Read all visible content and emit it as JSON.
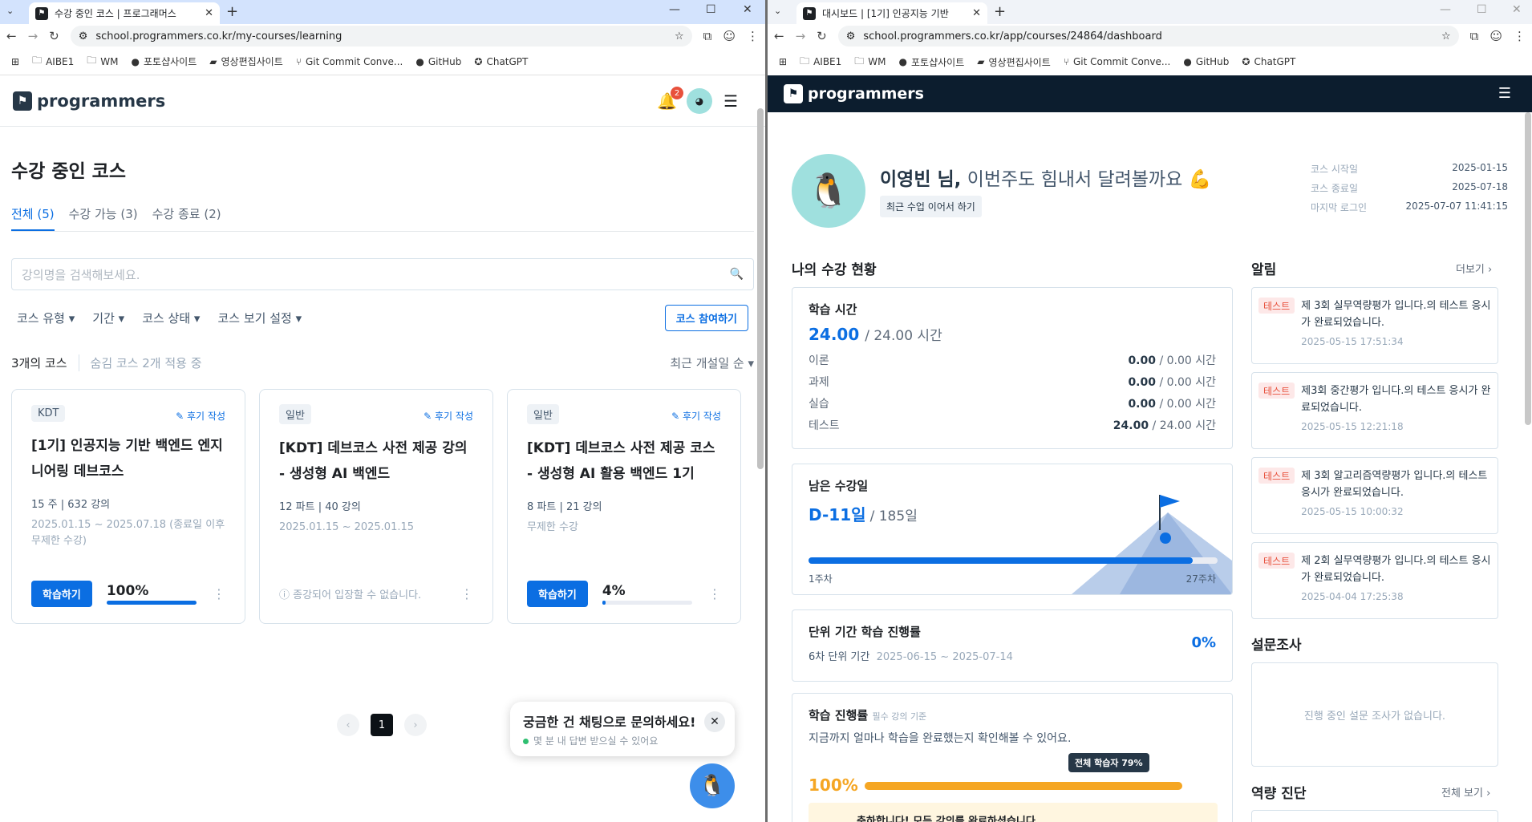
{
  "left": {
    "tab_title": "수강 중인 코스 | 프로그래머스",
    "url": "school.programmers.co.kr/my-courses/learning",
    "bookmarks": [
      "AIBE1",
      "WM",
      "포토샵사이트",
      "영상편집사이트",
      "Git Commit Conve...",
      "GitHub",
      "ChatGPT"
    ],
    "logo": "programmers",
    "notif_count": "2",
    "page_title": "수강 중인 코스",
    "tabs": [
      "전체 (5)",
      "수강 가능 (3)",
      "수강 종료 (2)"
    ],
    "search_placeholder": "강의명을 검색해보세요.",
    "filters": [
      "코스 유형 ▾",
      "기간 ▾",
      "코스 상태 ▾",
      "코스 보기 설정 ▾"
    ],
    "join_button": "코스 참여하기",
    "count": "3개의 코스",
    "hidden": "숨김 코스 2개 적용 중",
    "sort": "최근 개설일 순 ▾",
    "review_label": "후기 작성",
    "cards": [
      {
        "type": "KDT",
        "title": "[1기] 인공지능 기반 백엔드 엔지니어링 데브코스",
        "meta": "15 주 | 632 강의",
        "dates": "2025.01.15 ~ 2025.07.18 (종료일 이후 무제한 수강)",
        "button": "학습하기",
        "progress": "100%",
        "progress_value": 100,
        "note": ""
      },
      {
        "type": "일반",
        "title": "[KDT] 데브코스 사전 제공 강의 - 생성형 AI 백엔드",
        "meta": "12 파트 | 40 강의",
        "dates": "2025.01.15 ~ 2025.01.15",
        "button": "",
        "progress": "",
        "progress_value": 0,
        "note": "ⓘ 종강되어 입장할 수 없습니다."
      },
      {
        "type": "일반",
        "title": "[KDT] 데브코스 사전 제공 코스 - 생성형 AI 활용 백엔드 1기",
        "meta": "8 파트 | 21 강의",
        "dates": "무제한 수강",
        "button": "학습하기",
        "progress": "4%",
        "progress_value": 4,
        "note": ""
      }
    ],
    "page_num": "1",
    "chat_title": "궁금한 건 채팅으로 문의하세요!",
    "chat_sub": "몇 분 내 답변 받으실 수 있어요"
  },
  "right": {
    "tab_title": "대시보드 | [1기] 인공지능 기반",
    "url": "school.programmers.co.kr/app/courses/24864/dashboard",
    "logo": "programmers",
    "name": "이영빈 님,",
    "greeting": "이번주도 힘내서 달려볼까요 💪",
    "continue_btn": "최근 수업 이어서 하기",
    "info": [
      {
        "k": "코스 시작일",
        "v": "2025-01-15"
      },
      {
        "k": "코스 종료일",
        "v": "2025-07-18"
      },
      {
        "k": "마지막 로그인",
        "v": "2025-07-07 11:41:15"
      }
    ],
    "status_title": "나의 수강 현황",
    "study_time_label": "학습 시간",
    "study_time_value": "24.00",
    "study_time_total": "/ 24.00 시간",
    "study_rows": [
      {
        "k": "이론",
        "v": "0.00",
        "t": "/ 0.00 시간"
      },
      {
        "k": "과제",
        "v": "0.00",
        "t": "/ 0.00 시간"
      },
      {
        "k": "실습",
        "v": "0.00",
        "t": "/ 0.00 시간"
      },
      {
        "k": "테스트",
        "v": "24.00",
        "t": "/ 24.00 시간"
      }
    ],
    "remain_label": "남은 수강일",
    "remain_value": "D-11일",
    "remain_total": "/ 185일",
    "remain_progress": 94,
    "week_start": "1주차",
    "week_end": "27주차",
    "unit_label": "단위 기간 학습 진행률",
    "unit_period": "6차 단위 기간",
    "unit_dates": "2025-06-15 ~ 2025-07-14",
    "unit_pct": "0%",
    "prog_label": "학습 진행률",
    "prog_sub": "필수 강의 기준",
    "prog_desc": "지금까지 얼마나 학습을 완료했는지 확인해볼 수 있어요.",
    "prog_tip": "전체 학습자 79%",
    "prog_value": "100%",
    "prog_fill": 100,
    "congrats": "축하합니다! 모든 강의를 완료하셨습니다.",
    "alarm_title": "알림",
    "more": "더보기 ›",
    "alarms": [
      {
        "tag": "테스트",
        "text": "제 3회 실무역량평가 입니다.의 테스트 응시가 완료되었습니다.",
        "time": "2025-05-15 17:51:34"
      },
      {
        "tag": "테스트",
        "text": "제3회 중간평가 입니다.의 테스트 응시가 완료되었습니다.",
        "time": "2025-05-15 12:21:18"
      },
      {
        "tag": "테스트",
        "text": "제 3회 알고리즘역량평가 입니다.의 테스트 응시가 완료되었습니다.",
        "time": "2025-05-15 10:00:32"
      },
      {
        "tag": "테스트",
        "text": "제 2회 실무역량평가 입니다.의 테스트 응시가 완료되었습니다.",
        "time": "2025-04-04 17:25:38"
      }
    ],
    "survey_title": "설문조사",
    "survey_empty": "진행 중인 설문 조사가 없습니다.",
    "diag_title": "역량 진단",
    "diag_more": "전체 보기 ›"
  }
}
